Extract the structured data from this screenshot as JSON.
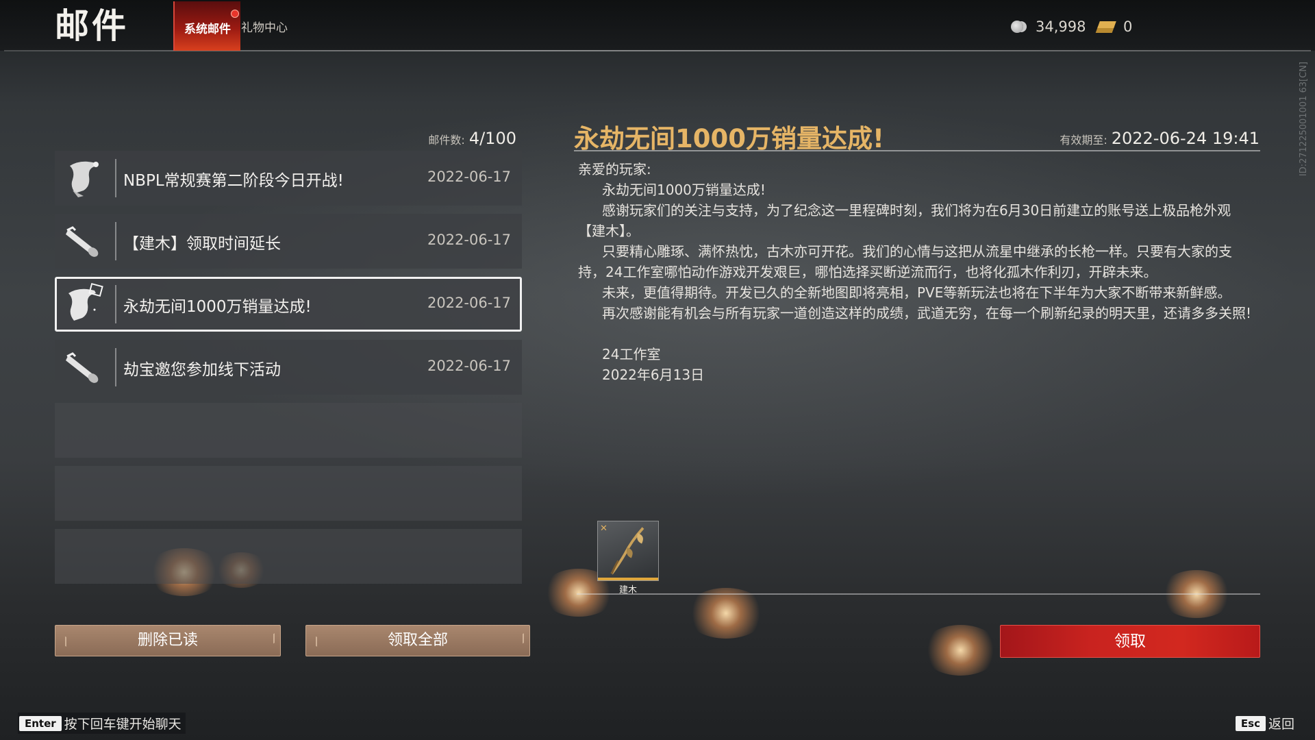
{
  "header": {
    "title": "邮件",
    "tabs": [
      {
        "label": "系统邮件",
        "active": true
      },
      {
        "label": "礼物中心",
        "active": false
      }
    ],
    "currencies": [
      {
        "icon": "silver-coin-icon",
        "value": "34,998"
      },
      {
        "icon": "gold-ingot-icon",
        "value": "0"
      }
    ]
  },
  "side_id": "ID:271225001001 63[CN]",
  "mail_list": {
    "count_label": "邮件数:",
    "count_value": "4/100",
    "items": [
      {
        "icon": "scroll-icon",
        "subject": "NBPL常规赛第二阶段今日开战!",
        "date": "2022-06-17",
        "selected": false
      },
      {
        "icon": "rolled-letter-icon",
        "subject": "【建木】领取时间延长",
        "date": "2022-06-17",
        "selected": false
      },
      {
        "icon": "scroll-gift-icon",
        "subject": "永劫无间1000万销量达成!",
        "date": "2022-06-17",
        "selected": true
      },
      {
        "icon": "rolled-letter-icon",
        "subject": "劫宝邀您参加线下活动",
        "date": "2022-06-17",
        "selected": false
      }
    ],
    "delete_read_label": "删除已读",
    "claim_all_label": "领取全部"
  },
  "mail_detail": {
    "title": "永劫无间1000万销量达成!",
    "expiry_label": "有效期至:",
    "expiry_value": "2022-06-24 19:41",
    "greeting": "亲爱的玩家:",
    "paragraphs": [
      "永劫无间1000万销量达成!",
      "感谢玩家们的关注与支持，为了纪念这一里程碑时刻，我们将为在6月30日前建立的账号送上极品枪外观【建木】。",
      "只要精心雕琢、满怀热忱，古木亦可开花。我们的心情与这把从流星中继承的长枪一样。只要有大家的支持，24工作室哪怕动作游戏开发艰巨，哪怕选择买断逆流而行，也将化孤木作利刃，开辟未来。",
      "未来，更值得期待。开发已久的全新地图即将亮相，PVE等新玩法也将在下半年为大家不断带来新鲜感。",
      "再次感谢能有机会与所有玩家一道创造这样的成绩，武道无穷，在每一个刷新纪录的明天里，还请多多关照!"
    ],
    "signature": "24工作室",
    "sign_date": "2022年6月13日",
    "attachment": {
      "icon": "spear-skin-icon",
      "name": "建木"
    },
    "claim_label": "领取"
  },
  "footer": {
    "chat_key": "Enter",
    "chat_hint": "按下回车键开始聊天",
    "back_key": "Esc",
    "back_label": "返回"
  },
  "colors": {
    "title_gold": "#e6b566",
    "tab_active_red": "#b8261a",
    "claim_red": "#c9231f",
    "button_brown": "#9a7a62"
  }
}
